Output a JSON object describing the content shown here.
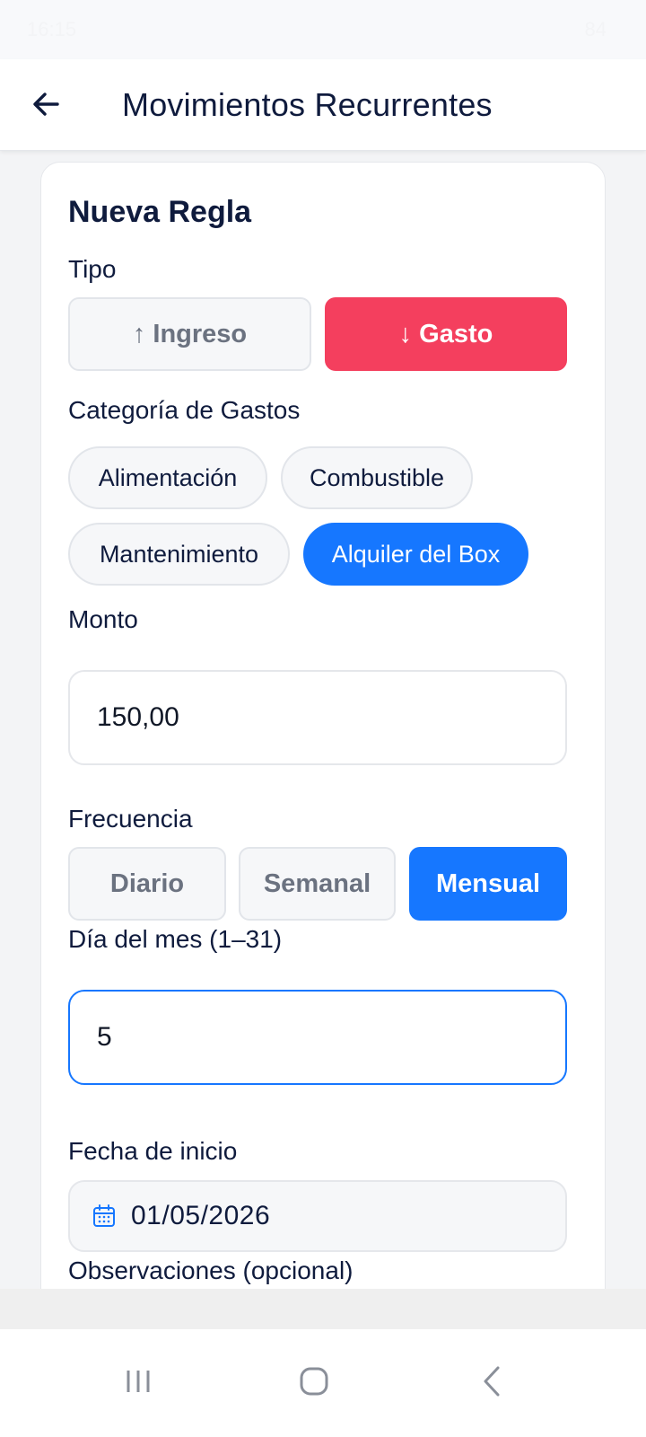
{
  "status_bar": {
    "time": "16:15",
    "battery": "84"
  },
  "header": {
    "title": "Movimientos Recurrentes"
  },
  "form": {
    "title": "Nueva Regla",
    "tipo": {
      "label": "Tipo",
      "options": [
        "↑ Ingreso",
        "↓ Gasto"
      ],
      "selected": "↓ Gasto"
    },
    "categoria": {
      "label": "Categoría de Gastos",
      "options": [
        "Alimentación",
        "Combustible",
        "Mantenimiento",
        "Alquiler del Box"
      ],
      "selected": "Alquiler del Box"
    },
    "monto": {
      "label": "Monto",
      "value": "150,00"
    },
    "frecuencia": {
      "label": "Frecuencia",
      "options": [
        "Diario",
        "Semanal",
        "Mensual"
      ],
      "selected": "Mensual"
    },
    "dia_mes": {
      "label": "Día del mes (1–31)",
      "value": "5"
    },
    "fecha_inicio": {
      "label": "Fecha de inicio",
      "value": "01/05/2026"
    },
    "observaciones": {
      "label": "Observaciones (opcional)"
    }
  },
  "colors": {
    "expense": "#f43f5e",
    "accent": "#1677ff",
    "text": "#0f1b3d"
  },
  "icons": [
    "back-arrow-icon",
    "calendar-icon",
    "recents-icon",
    "home-icon",
    "back-icon"
  ]
}
